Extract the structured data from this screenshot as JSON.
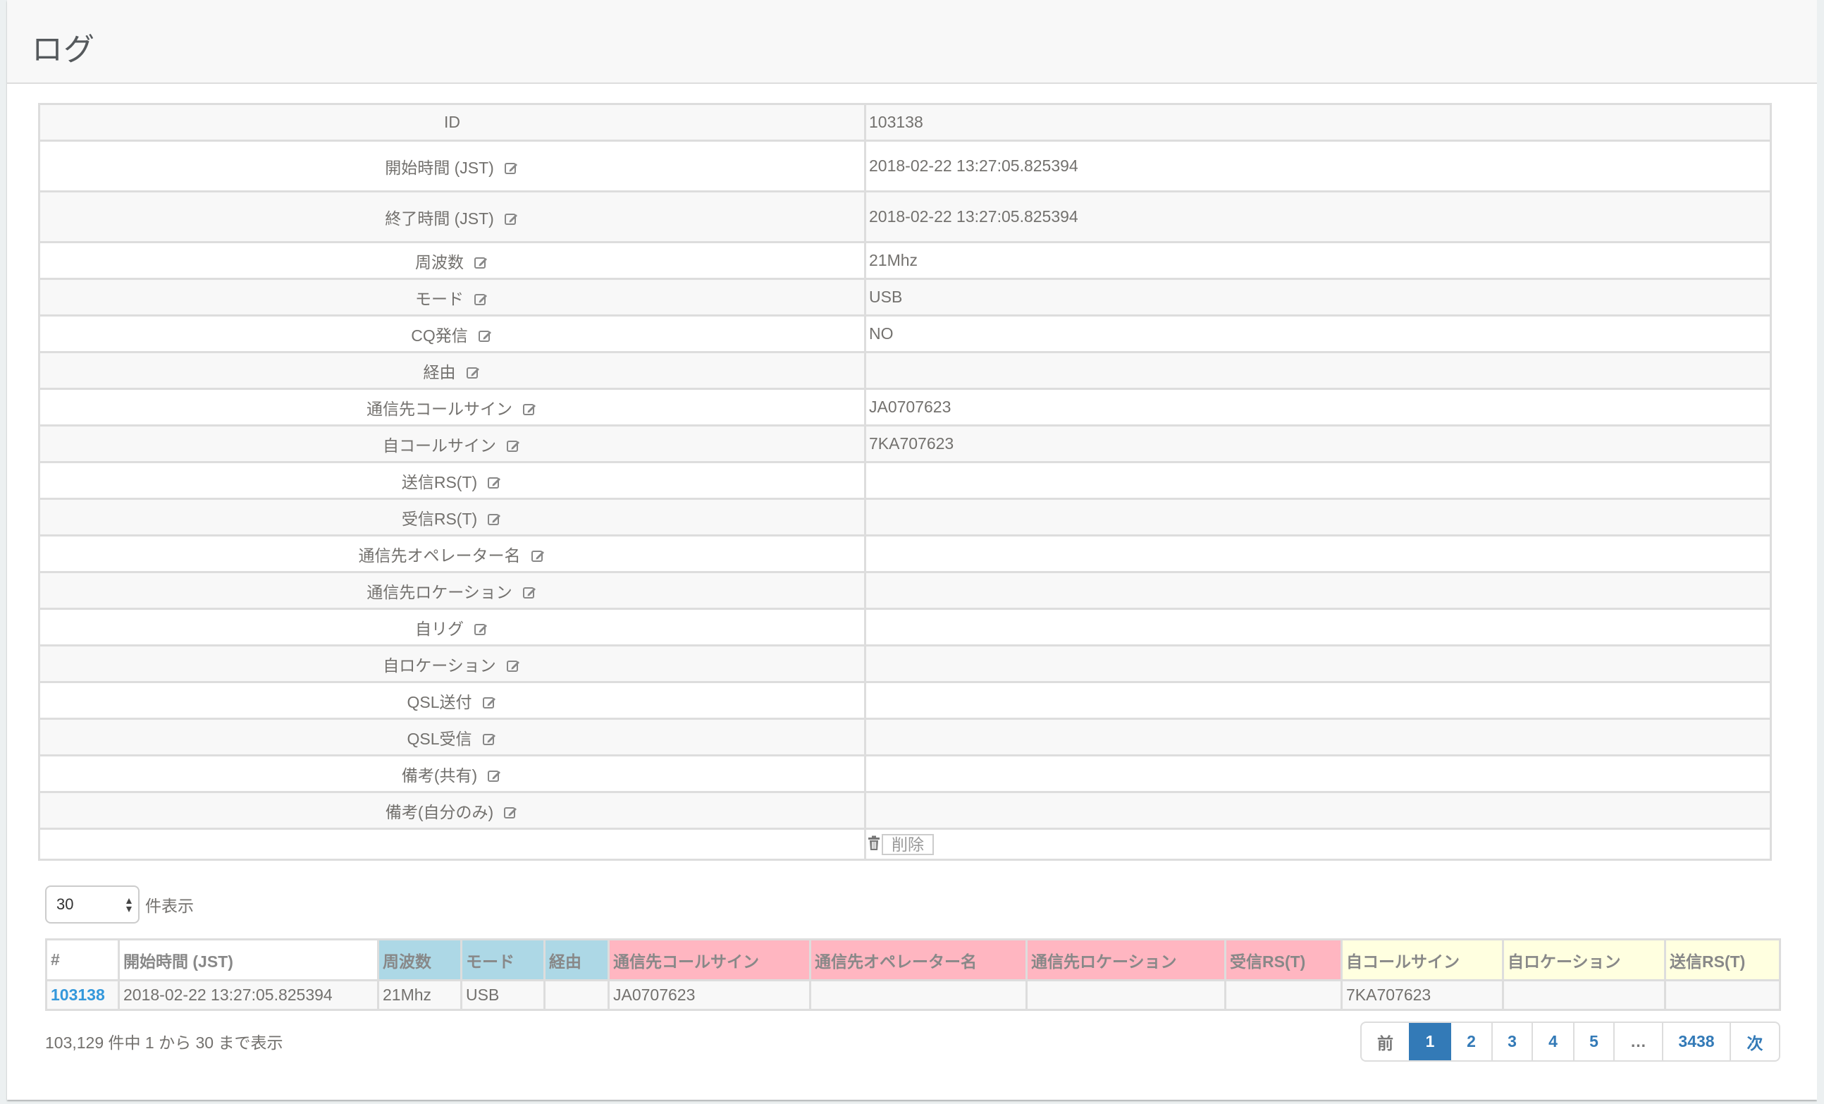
{
  "page": {
    "title": "ログ"
  },
  "detail": {
    "id_label": "ID",
    "id_value": "103138",
    "rows": [
      {
        "label": "開始時間 (JST)",
        "value": "2018-02-22 13:27:05.825394"
      },
      {
        "label": "終了時間 (JST)",
        "value": "2018-02-22 13:27:05.825394"
      },
      {
        "label": "周波数",
        "value": "21Mhz"
      },
      {
        "label": "モード",
        "value": "USB"
      },
      {
        "label": "CQ発信",
        "value": "NO"
      },
      {
        "label": "経由",
        "value": ""
      },
      {
        "label": "通信先コールサイン",
        "value": "JA0707623"
      },
      {
        "label": "自コールサイン",
        "value": "7KA707623"
      },
      {
        "label": "送信RS(T)",
        "value": ""
      },
      {
        "label": "受信RS(T)",
        "value": ""
      },
      {
        "label": "通信先オペレーター名",
        "value": ""
      },
      {
        "label": "通信先ロケーション",
        "value": ""
      },
      {
        "label": "自リグ",
        "value": ""
      },
      {
        "label": "自ロケーション",
        "value": ""
      },
      {
        "label": "QSL送付",
        "value": ""
      },
      {
        "label": "QSL受信",
        "value": ""
      },
      {
        "label": "備考(共有)",
        "value": ""
      },
      {
        "label": "備考(自分のみ)",
        "value": ""
      }
    ],
    "delete_label": "削除",
    "edit_icon": "edit-icon",
    "delete_icon": "trash-icon"
  },
  "length": {
    "selected": "30",
    "label": "件表示"
  },
  "list": {
    "columns": [
      {
        "label": "#",
        "group": "white"
      },
      {
        "label": "開始時間 (JST)",
        "group": "white"
      },
      {
        "label": "周波数",
        "group": "blue"
      },
      {
        "label": "モード",
        "group": "blue"
      },
      {
        "label": "経由",
        "group": "blue"
      },
      {
        "label": "通信先コールサイン",
        "group": "pink"
      },
      {
        "label": "通信先オペレーター名",
        "group": "pink"
      },
      {
        "label": "通信先ロケーション",
        "group": "pink"
      },
      {
        "label": "受信RS(T)",
        "group": "pink"
      },
      {
        "label": "自コールサイン",
        "group": "yellow"
      },
      {
        "label": "自ロケーション",
        "group": "yellow"
      },
      {
        "label": "送信RS(T)",
        "group": "yellow"
      }
    ],
    "rows": [
      [
        "103138",
        "2018-02-22 13:27:05.825394",
        "21Mhz",
        "USB",
        "",
        "JA0707623",
        "",
        "",
        "",
        "7KA707623",
        "",
        ""
      ]
    ],
    "group_colors": {
      "white": "#ffffff",
      "blue": "#add8e6",
      "pink": "#ffb6c1",
      "yellow": "#ffffe0"
    }
  },
  "info": {
    "text": "103,129 件中 1 から 30 まで表示"
  },
  "pagination": {
    "prev": "前",
    "pages": [
      "1",
      "2",
      "3",
      "4",
      "5"
    ],
    "ellipsis": "…",
    "last": "3438",
    "next": "次",
    "current": "1",
    "active_color": "#337ab7"
  }
}
